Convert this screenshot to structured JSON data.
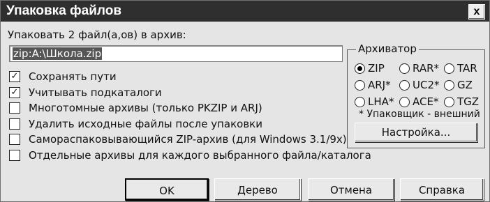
{
  "window": {
    "title": "Упаковка файлов",
    "close_glyph": "x"
  },
  "main": {
    "prompt": "Упаковать 2 файл(а,ов) в архив:",
    "archive_path": "zip:A:\\Школа.zip",
    "options": [
      {
        "label": "Сохранять пути",
        "checked": true
      },
      {
        "label": "Учитывать подкаталоги",
        "checked": true
      },
      {
        "label": "Многотомные архивы (только PKZIP и ARJ)",
        "checked": false
      },
      {
        "label": "Удалить исходные файлы после упаковки",
        "checked": false
      },
      {
        "label": "Самораспаковывающийся ZIP-архив (для Windows 3.1/9x)",
        "checked": false
      },
      {
        "label": "Отдельные архивы для каждого выбранного файла/каталога",
        "checked": false
      }
    ]
  },
  "archiver": {
    "title": "Архиватор",
    "options": [
      {
        "label": "ZIP",
        "selected": true
      },
      {
        "label": "RAR*",
        "selected": false
      },
      {
        "label": "TAR",
        "selected": false
      },
      {
        "label": "ARJ*",
        "selected": false
      },
      {
        "label": "UC2*",
        "selected": false
      },
      {
        "label": "GZ",
        "selected": false
      },
      {
        "label": "LHA*",
        "selected": false
      },
      {
        "label": "ACE*",
        "selected": false
      },
      {
        "label": "TGZ",
        "selected": false
      }
    ],
    "note": "* Упаковщик - внешний",
    "setup_label": "Настройка..."
  },
  "buttons": {
    "ok": "OK",
    "tree": "Дерево",
    "cancel": "Отмена",
    "help": "Справка"
  }
}
